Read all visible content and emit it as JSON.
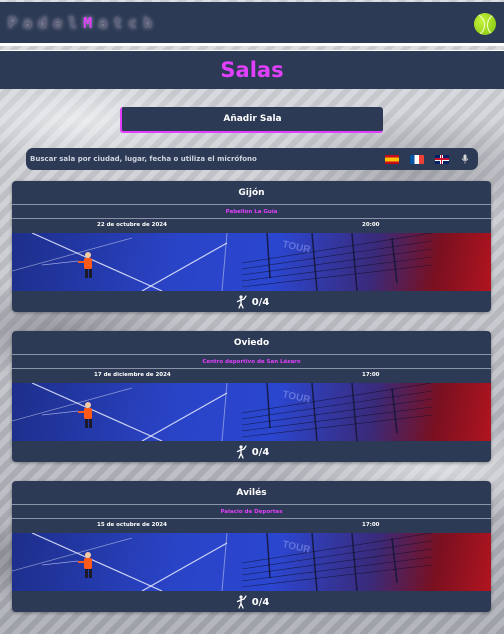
{
  "app": {
    "logo_parts": [
      {
        "text": "Padel",
        "accent": false
      },
      {
        "text": "M",
        "accent": true
      },
      {
        "text": "atch",
        "accent": false
      }
    ]
  },
  "page": {
    "title": "Salas"
  },
  "actions": {
    "add_room_label": "Añadir Sala"
  },
  "search": {
    "placeholder": "Buscar sala por ciudad, lugar, fecha o utiliza el micrófono",
    "languages": [
      "es",
      "fr",
      "gb"
    ]
  },
  "rooms": [
    {
      "city": "Gijón",
      "venue": "Pabellon La Guía",
      "date": "22 de octubre de 2024",
      "time": "20:00",
      "players": "0/4"
    },
    {
      "city": "Oviedo",
      "venue": "Centro deportivo de San Lázaro",
      "date": "17 de diciembre de 2024",
      "time": "17:00",
      "players": "0/4"
    },
    {
      "city": "Avilés",
      "venue": "Palacio de Deportes",
      "date": "15 de octubre de 2024",
      "time": "17:00",
      "players": "0/4"
    }
  ],
  "colors": {
    "accent": "#e040fb",
    "panel": "#2d3a55"
  },
  "icons": {
    "language": [
      "flag-es-icon",
      "flag-fr-icon",
      "flag-gb-icon"
    ],
    "mic": "microphone-icon",
    "players": "player-icon",
    "brand": "tennis-ball-icon"
  }
}
